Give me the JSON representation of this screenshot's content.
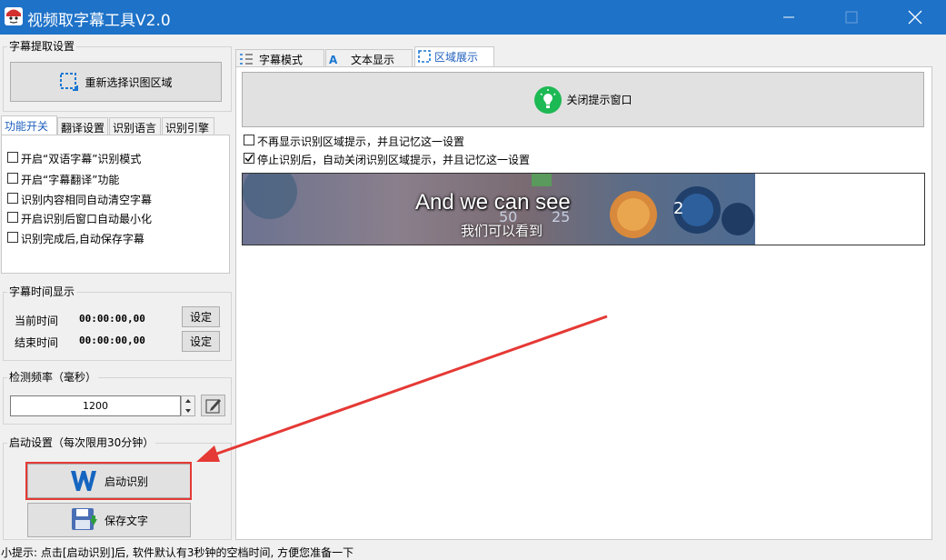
{
  "window": {
    "title": "视频取字幕工具V2.0"
  },
  "capture": {
    "group_title": "字幕提取设置",
    "reselect_label": "重新选择识图区域"
  },
  "left_tabs": [
    "功能开关",
    "翻译设置",
    "识别语言",
    "识别引擎"
  ],
  "function_switches": [
    {
      "label": "开启“双语字幕”识别模式",
      "checked": false
    },
    {
      "label": "开启“字幕翻译”功能",
      "checked": false
    },
    {
      "label": "识别内容相同自动清空字幕",
      "checked": false
    },
    {
      "label": "开启识别后窗口自动最小化",
      "checked": false
    },
    {
      "label": "识别完成后,自动保存字幕",
      "checked": false
    }
  ],
  "time_display": {
    "group_title": "字幕时间显示",
    "current_label": "当前时间",
    "current_value": "00:00:00,00",
    "end_label": "结束时间",
    "end_value": "00:00:00,00",
    "set_label": "设定"
  },
  "frequency": {
    "group_title": "检测频率（毫秒）",
    "value": "1200"
  },
  "start": {
    "group_title": "启动设置（每次限用30分钟）",
    "start_label": "启动识别",
    "save_label": "保存文字"
  },
  "right_tabs": [
    "字幕模式",
    "文本显示",
    "区域展示"
  ],
  "region": {
    "close_tip_label": "关闭提示窗口",
    "option1": {
      "label": "不再显示识别区域提示，并且记忆这一设置",
      "checked": false
    },
    "option2": {
      "label": "停止识别后，自动关闭识别区域提示，并且记忆这一设置",
      "checked": true
    },
    "preview": {
      "subtitle_en": "And we can see",
      "subtitle_zh": "我们可以看到",
      "hud_left": "50",
      "hud_mid": "25",
      "hud_right": "2"
    }
  },
  "status_bar": {
    "text": "小提示: 点击[启动识别]后, 软件默认有3秒钟的空档时间, 方便您准备一下"
  },
  "colors": {
    "titlebar": "#1e72c8",
    "annotation": "#e53935",
    "start_icon": "#1565c0",
    "tip_icon": "#1db954"
  }
}
